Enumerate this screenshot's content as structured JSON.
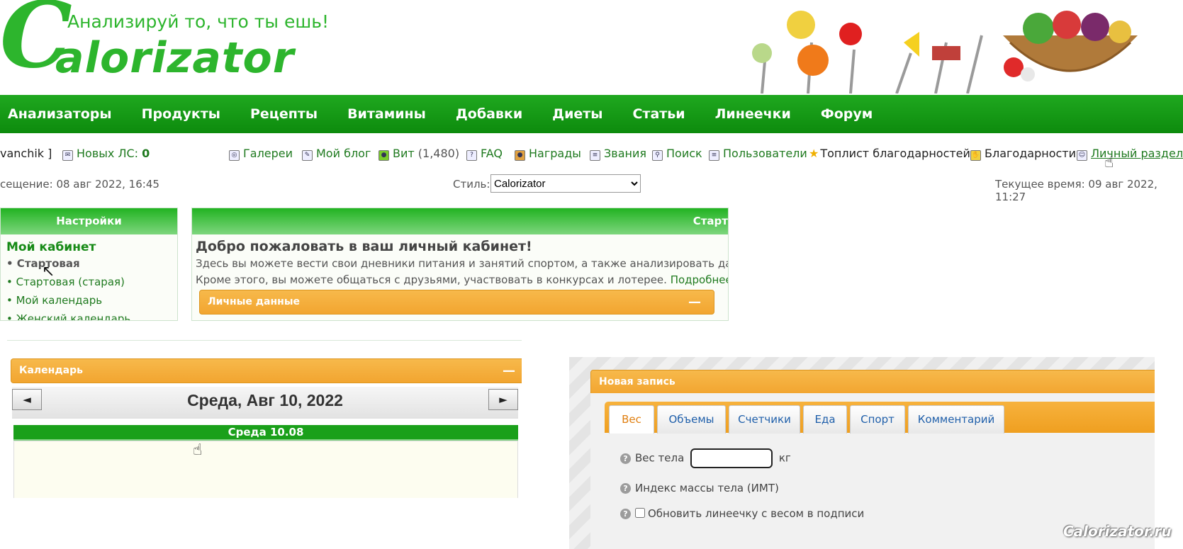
{
  "header": {
    "logo_c": "C",
    "logo_word": "alorizator",
    "tagline": "Анализируй то, что ты ешь!"
  },
  "nav": [
    "Анализаторы",
    "Продукты",
    "Рецепты",
    "Витамины",
    "Добавки",
    "Диеты",
    "Статьи",
    "Линеечки",
    "Форум"
  ],
  "infobar": {
    "username": "vanchik ]",
    "new_pm_label": "Новых ЛС:",
    "new_pm_count": "0",
    "links": {
      "galleries": "Галереи",
      "my_blog": "Мой блог",
      "vit": "Вит",
      "vit_count": "(1,480)",
      "faq": "FAQ",
      "awards": "Награды",
      "ranks": "Звания",
      "search": "Поиск",
      "users": "Пользователи",
      "toplist": "Топлист благодарностей",
      "thanks": "Благодарности",
      "personal": "Личный раздел"
    }
  },
  "row2": {
    "last_visit": "сещение: 08 авг 2022, 16:45",
    "style_label": "Стиль:",
    "style_value": "Calorizator",
    "current_time": "Текущее время: 09 авг 2022, 11:27"
  },
  "sidebar": {
    "header": "Настройки",
    "title": "Мой кабинет",
    "items": [
      "• Стартовая",
      "• Стартовая (старая)",
      "• Мой календарь",
      "• Женский календарь"
    ]
  },
  "main": {
    "header": "Старт",
    "welcome": "Добро пожаловать в ваш личный кабинет!",
    "line1": "Здесь вы можете вести свои дневники питания и занятий спортом, а также анализировать дан",
    "line2": "Кроме этого, вы можете общаться с друзьями, участвовать в конкурсах и лотерее.",
    "more": "Подробнее",
    "personal_bar": "Личные данные",
    "collapse": "—"
  },
  "calendar": {
    "header": "Календарь",
    "collapse": "—",
    "prev": "◄",
    "next": "►",
    "date": "Среда, Авг 10, 2022",
    "day_head": "Среда 10.08"
  },
  "entry": {
    "header": "Новая запись",
    "tabs": [
      "Вес",
      "Объемы",
      "Счетчики",
      "Еда",
      "Спорт",
      "Комментарий"
    ],
    "weight_label": "Вес тела",
    "weight_unit": "кг",
    "bmi_label": "Индекс массы тела (ИМТ)",
    "update_label": "Обновить линеечку с весом в подписи"
  },
  "watermark": "Calorizator.ru",
  "colors": {
    "brand_green": "#2db52d",
    "nav_green": "#0d8b0d",
    "orange": "#f2a530",
    "tab_blue": "#1f5faa"
  }
}
